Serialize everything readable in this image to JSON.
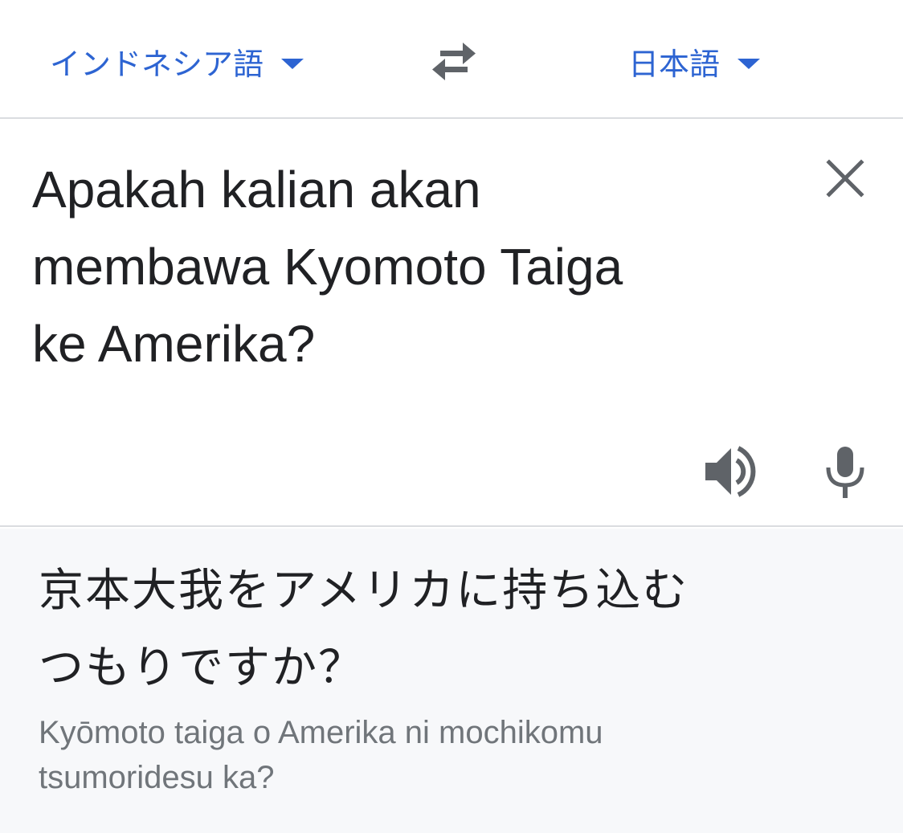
{
  "language_bar": {
    "source_language": "インドネシア語",
    "target_language": "日本語",
    "swap_icon": "swap-arrows-icon",
    "dropdown_icon": "caret-down-icon"
  },
  "input": {
    "text_lines": [
      "Apakah kalian akan",
      "membawa Kyomoto Taiga",
      "ke Amerika?"
    ],
    "clear_icon": "close-icon",
    "speaker_icon": "speaker-icon",
    "mic_icon": "microphone-icon"
  },
  "output": {
    "translation_lines": [
      "京本大我をアメリカに持ち込む",
      "つもりですか？"
    ],
    "romanization_lines": [
      "Kyōmoto taiga o Amerika ni mochikomu",
      "tsumoridesu ka?"
    ]
  },
  "colors": {
    "accent": "#2d64d2",
    "text": "#202124",
    "secondary_text": "#70757a",
    "icon_gray": "#5f6368",
    "output_background": "#f7f8fa",
    "divider": "#dadce0"
  }
}
